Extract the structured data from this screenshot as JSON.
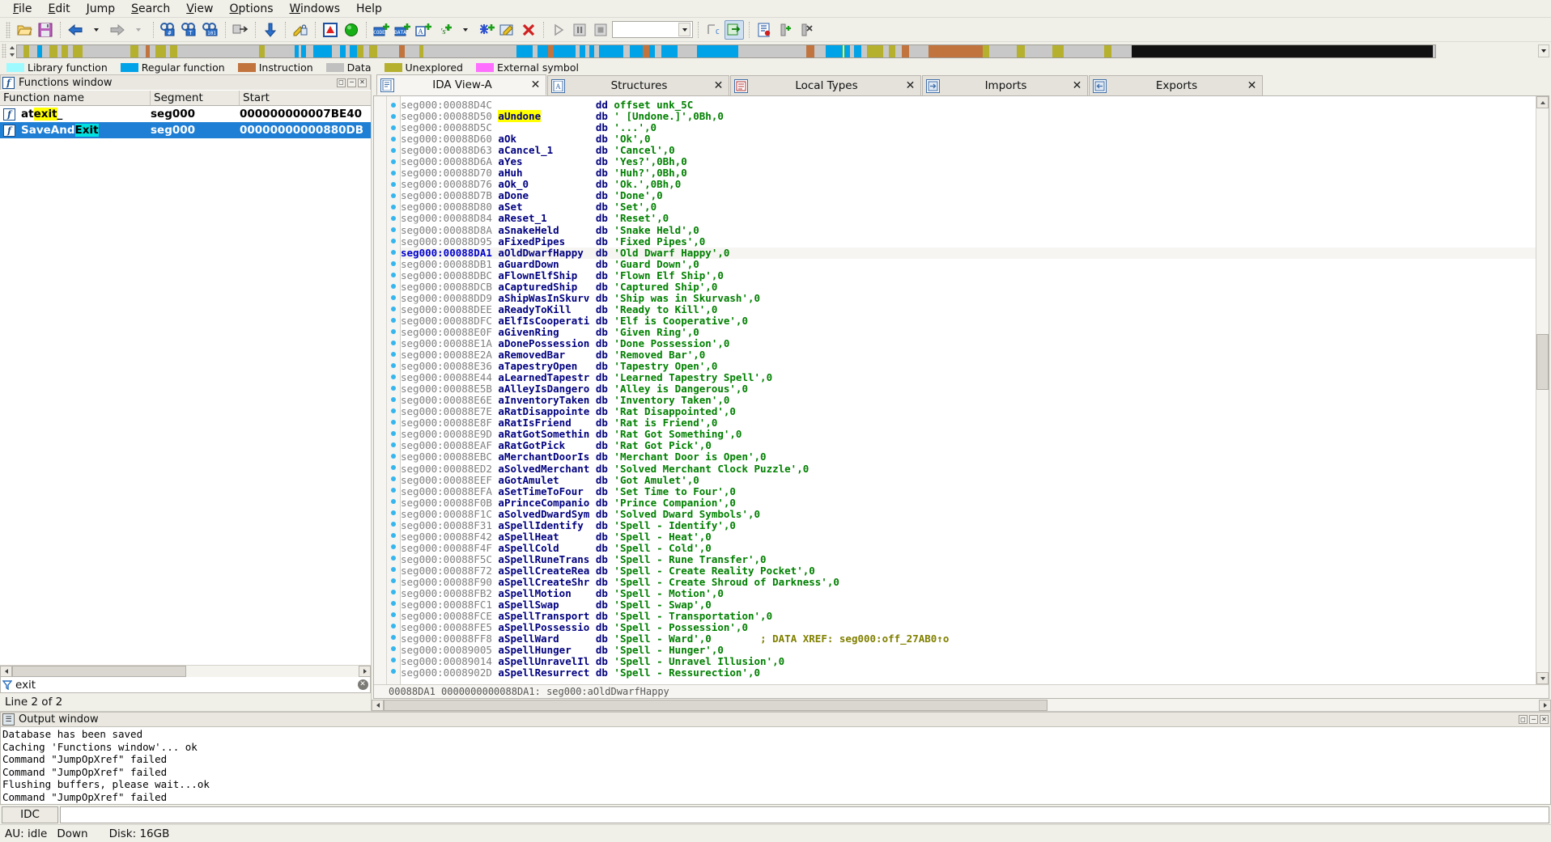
{
  "menu": {
    "items": [
      {
        "label": "File",
        "accel": "F"
      },
      {
        "label": "Edit",
        "accel": "E"
      },
      {
        "label": "Jump",
        "accel": "J"
      },
      {
        "label": "Search",
        "accel": "S"
      },
      {
        "label": "View",
        "accel": "V"
      },
      {
        "label": "Options",
        "accel": "O"
      },
      {
        "label": "Windows",
        "accel": "W"
      },
      {
        "label": "Help",
        "accel": "H"
      }
    ]
  },
  "toolbar": {
    "combo_value": "",
    "icons": [
      "open-file-icon",
      "save-icon",
      "navigate-back-icon",
      "back-dropdown-icon",
      "navigate-forward-icon",
      "forward-dropdown-icon",
      "search-hash-icon",
      "search-text-icon",
      "search-binary-icon",
      "jump-xref-icon",
      "jump-down-icon",
      "edit-function-icon",
      "warning-icon",
      "run-icon",
      "make-code-icon",
      "make-data-icon",
      "make-ascii-icon",
      "make-struct-icon",
      "struct-dropdown-icon",
      "make-unexplored-icon",
      "edit-icon",
      "delete-icon",
      "run-debugger-icon",
      "pause-icon",
      "stop-icon",
      "trace-icon",
      "step-icon",
      "notepad-icon",
      "breakpoint-add-icon",
      "breakpoint-delete-icon"
    ]
  },
  "navband": {
    "segments": [
      {
        "color": "#c8c8c8",
        "width": 0.5
      },
      {
        "color": "#b5b02e",
        "width": 0.4
      },
      {
        "color": "#c8c8c8",
        "width": 0.6
      },
      {
        "color": "#00a2e8",
        "width": 0.35
      },
      {
        "color": "#c8c8c8",
        "width": 0.5
      },
      {
        "color": "#b5b02e",
        "width": 0.6
      },
      {
        "color": "#c8c8c8",
        "width": 0.3
      },
      {
        "color": "#b5b02e",
        "width": 0.5
      },
      {
        "color": "#c8c8c8",
        "width": 0.35
      },
      {
        "color": "#b5b02e",
        "width": 0.7
      },
      {
        "color": "#c8c8c8",
        "width": 3.5
      },
      {
        "color": "#b5b02e",
        "width": 0.6
      },
      {
        "color": "#c8c8c8",
        "width": 0.5
      },
      {
        "color": "#c1743e",
        "width": 0.3
      },
      {
        "color": "#c8c8c8",
        "width": 0.4
      },
      {
        "color": "#b5b02e",
        "width": 0.8
      },
      {
        "color": "#c8c8c8",
        "width": 0.3
      },
      {
        "color": "#b5b02e",
        "width": 0.5
      },
      {
        "color": "#c8c8c8",
        "width": 6.0
      },
      {
        "color": "#b5b02e",
        "width": 0.4
      },
      {
        "color": "#c8c8c8",
        "width": 2.2
      },
      {
        "color": "#00a2e8",
        "width": 0.3
      },
      {
        "color": "#c8c8c8",
        "width": 0.2
      },
      {
        "color": "#00a2e8",
        "width": 0.35
      },
      {
        "color": "#c8c8c8",
        "width": 0.5
      },
      {
        "color": "#00a2e8",
        "width": 1.4
      },
      {
        "color": "#c8c8c8",
        "width": 0.6
      },
      {
        "color": "#00a2e8",
        "width": 0.4
      },
      {
        "color": "#c8c8c8",
        "width": 0.3
      },
      {
        "color": "#00a2e8",
        "width": 0.5
      },
      {
        "color": "#b5b02e",
        "width": 0.5
      },
      {
        "color": "#c8c8c8",
        "width": 0.4
      },
      {
        "color": "#b5b02e",
        "width": 0.6
      },
      {
        "color": "#c8c8c8",
        "width": 1.6
      },
      {
        "color": "#c1743e",
        "width": 0.4
      },
      {
        "color": "#c8c8c8",
        "width": 1.1
      },
      {
        "color": "#b5b02e",
        "width": 0.3
      },
      {
        "color": "#c8c8c8",
        "width": 6.8
      },
      {
        "color": "#00a2e8",
        "width": 1.2
      },
      {
        "color": "#c8c8c8",
        "width": 0.3
      },
      {
        "color": "#00a2e8",
        "width": 0.8
      },
      {
        "color": "#c1743e",
        "width": 0.4
      },
      {
        "color": "#00a2e8",
        "width": 1.6
      },
      {
        "color": "#c8c8c8",
        "width": 0.3
      },
      {
        "color": "#00a2e8",
        "width": 0.4
      },
      {
        "color": "#c8c8c8",
        "width": 0.3
      },
      {
        "color": "#00a2e8",
        "width": 0.4
      },
      {
        "color": "#c8c8c8",
        "width": 0.3
      },
      {
        "color": "#00a2e8",
        "width": 1.8
      },
      {
        "color": "#c8c8c8",
        "width": 0.5
      },
      {
        "color": "#00a2e8",
        "width": 0.9
      },
      {
        "color": "#c1743e",
        "width": 0.5
      },
      {
        "color": "#00a2e8",
        "width": 0.4
      },
      {
        "color": "#c8c8c8",
        "width": 0.5
      },
      {
        "color": "#00a2e8",
        "width": 1.2
      },
      {
        "color": "#c8c8c8",
        "width": 1.4
      },
      {
        "color": "#00a2e8",
        "width": 3.0
      },
      {
        "color": "#c8c8c8",
        "width": 5.0
      },
      {
        "color": "#c1743e",
        "width": 0.6
      },
      {
        "color": "#c8c8c8",
        "width": 0.8
      },
      {
        "color": "#00a2e8",
        "width": 1.8
      },
      {
        "color": "#c8c8c8",
        "width": 0.3
      },
      {
        "color": "#00a2e8",
        "width": 0.5
      },
      {
        "color": "#c8c8c8",
        "width": 0.4
      },
      {
        "color": "#b5b02e",
        "width": 1.2
      },
      {
        "color": "#c8c8c8",
        "width": 0.4
      },
      {
        "color": "#b5b02e",
        "width": 0.5
      },
      {
        "color": "#c8c8c8",
        "width": 0.5
      },
      {
        "color": "#c1743e",
        "width": 0.5
      },
      {
        "color": "#c8c8c8",
        "width": 1.4
      },
      {
        "color": "#c1743e",
        "width": 4.0
      },
      {
        "color": "#b5b02e",
        "width": 0.5
      },
      {
        "color": "#c8c8c8",
        "width": 2.0
      },
      {
        "color": "#b5b02e",
        "width": 0.6
      },
      {
        "color": "#c8c8c8",
        "width": 2.0
      },
      {
        "color": "#b5b02e",
        "width": 0.8
      },
      {
        "color": "#c8c8c8",
        "width": 3.0
      },
      {
        "color": "#b5b02e",
        "width": 0.5
      },
      {
        "color": "#c8c8c8",
        "width": 1.5
      },
      {
        "color": "#111111",
        "width": 22.0
      },
      {
        "color": "#c8c8c8",
        "width": 0.2
      }
    ]
  },
  "legend": {
    "entries": [
      {
        "label": "Library function",
        "color": "#9ffaff"
      },
      {
        "label": "Regular function",
        "color": "#00a2e8"
      },
      {
        "label": "Instruction",
        "color": "#c1743e"
      },
      {
        "label": "Data",
        "color": "#c0c0c0"
      },
      {
        "label": "Unexplored",
        "color": "#b5b02e"
      },
      {
        "label": "External symbol",
        "color": "#ff6fff"
      }
    ]
  },
  "functions_window": {
    "title": "Functions window",
    "title_icon": "function-icon",
    "window_buttons": [
      "restore-button",
      "minimize-button",
      "close-button"
    ],
    "columns": [
      "Function name",
      "Segment",
      "Start"
    ],
    "rows": [
      {
        "icon": "function-icon",
        "name_pre": "at",
        "name_hl": "exit",
        "name_hl_color": "#ffff00",
        "name_post": "_",
        "segment": "seg000",
        "start": "000000000007BE40",
        "selected": false
      },
      {
        "icon": "function-icon",
        "name_pre": "SaveAnd",
        "name_hl": "Exit",
        "name_hl_color": "#00e0e0",
        "name_post": "",
        "segment": "seg000",
        "start": "00000000000880DB",
        "selected": true
      }
    ],
    "filter_value": "exit",
    "filter_placeholder": "",
    "status": "Line 2 of 2"
  },
  "tabs": [
    {
      "label": "IDA View-A",
      "icon": "ida-view-icon",
      "active": true,
      "close": "✕"
    },
    {
      "label": "Structures",
      "icon": "structures-icon",
      "active": false,
      "close": "✕"
    },
    {
      "label": "Local Types",
      "icon": "local-types-icon",
      "active": false,
      "close": "✕"
    },
    {
      "label": "Imports",
      "icon": "imports-icon",
      "active": false,
      "close": "✕"
    },
    {
      "label": "Exports",
      "icon": "exports-icon",
      "active": false,
      "close": "✕"
    }
  ],
  "disassembly": {
    "status_line": "00088DA1 0000000000088DA1: seg000:aOldDwarfHappy",
    "lines": [
      {
        "addr": "seg000:00088D4C",
        "name": "",
        "op": "dd",
        "operand": "offset unk_5C",
        "operand_kind": "name",
        "cur": false
      },
      {
        "addr": "seg000:00088D50",
        "name": "aUndone",
        "name_hl": true,
        "op": "db",
        "operand": "' [Undone.]',0Bh,0",
        "cur": false
      },
      {
        "addr": "seg000:00088D5C",
        "name": "",
        "op": "db",
        "operand": "'...',0",
        "cur": false
      },
      {
        "addr": "seg000:00088D60",
        "name": "aOk",
        "op": "db",
        "operand": "'Ok',0",
        "cur": false
      },
      {
        "addr": "seg000:00088D63",
        "name": "aCancel_1",
        "op": "db",
        "operand": "'Cancel',0",
        "cur": false
      },
      {
        "addr": "seg000:00088D6A",
        "name": "aYes",
        "op": "db",
        "operand": "'Yes?',0Bh,0",
        "cur": false
      },
      {
        "addr": "seg000:00088D70",
        "name": "aHuh",
        "op": "db",
        "operand": "'Huh?',0Bh,0",
        "cur": false
      },
      {
        "addr": "seg000:00088D76",
        "name": "aOk_0",
        "op": "db",
        "operand": "'Ok.',0Bh,0",
        "cur": false
      },
      {
        "addr": "seg000:00088D7B",
        "name": "aDone",
        "op": "db",
        "operand": "'Done',0",
        "cur": false
      },
      {
        "addr": "seg000:00088D80",
        "name": "aSet",
        "op": "db",
        "operand": "'Set',0",
        "cur": false
      },
      {
        "addr": "seg000:00088D84",
        "name": "aReset_1",
        "op": "db",
        "operand": "'Reset',0",
        "cur": false
      },
      {
        "addr": "seg000:00088D8A",
        "name": "aSnakeHeld",
        "op": "db",
        "operand": "'Snake Held',0",
        "cur": false
      },
      {
        "addr": "seg000:00088D95",
        "name": "aFixedPipes",
        "op": "db",
        "operand": "'Fixed Pipes',0",
        "cur": false
      },
      {
        "addr": "seg000:00088DA1",
        "name": "aOldDwarfHappy",
        "op": "db",
        "operand": "'Old Dwarf Happy',0",
        "cur": true
      },
      {
        "addr": "seg000:00088DB1",
        "name": "aGuardDown",
        "op": "db",
        "operand": "'Guard Down',0",
        "cur": false
      },
      {
        "addr": "seg000:00088DBC",
        "name": "aFlownElfShip",
        "op": "db",
        "operand": "'Flown Elf Ship',0",
        "cur": false
      },
      {
        "addr": "seg000:00088DCB",
        "name": "aCapturedShip",
        "op": "db",
        "operand": "'Captured Ship',0",
        "cur": false
      },
      {
        "addr": "seg000:00088DD9",
        "name": "aShipWasInSkurv",
        "op": "db",
        "operand": "'Ship was in Skurvash',0",
        "cur": false
      },
      {
        "addr": "seg000:00088DEE",
        "name": "aReadyToKill",
        "op": "db",
        "operand": "'Ready to Kill',0",
        "cur": false
      },
      {
        "addr": "seg000:00088DFC",
        "name": "aElfIsCooperati",
        "op": "db",
        "operand": "'Elf is Cooperative',0",
        "cur": false
      },
      {
        "addr": "seg000:00088E0F",
        "name": "aGivenRing",
        "op": "db",
        "operand": "'Given Ring',0",
        "cur": false
      },
      {
        "addr": "seg000:00088E1A",
        "name": "aDonePossession",
        "op": "db",
        "operand": "'Done Possession',0",
        "cur": false
      },
      {
        "addr": "seg000:00088E2A",
        "name": "aRemovedBar",
        "op": "db",
        "operand": "'Removed Bar',0",
        "cur": false
      },
      {
        "addr": "seg000:00088E36",
        "name": "aTapestryOpen",
        "op": "db",
        "operand": "'Tapestry Open',0",
        "cur": false
      },
      {
        "addr": "seg000:00088E44",
        "name": "aLearnedTapestr",
        "op": "db",
        "operand": "'Learned Tapestry Spell',0",
        "cur": false
      },
      {
        "addr": "seg000:00088E5B",
        "name": "aAlleyIsDangero",
        "op": "db",
        "operand": "'Alley is Dangerous',0",
        "cur": false
      },
      {
        "addr": "seg000:00088E6E",
        "name": "aInventoryTaken",
        "op": "db",
        "operand": "'Inventory Taken',0",
        "cur": false
      },
      {
        "addr": "seg000:00088E7E",
        "name": "aRatDisappointe",
        "op": "db",
        "operand": "'Rat Disappointed',0",
        "cur": false
      },
      {
        "addr": "seg000:00088E8F",
        "name": "aRatIsFriend",
        "op": "db",
        "operand": "'Rat is Friend',0",
        "cur": false
      },
      {
        "addr": "seg000:00088E9D",
        "name": "aRatGotSomethin",
        "op": "db",
        "operand": "'Rat Got Something',0",
        "cur": false
      },
      {
        "addr": "seg000:00088EAF",
        "name": "aRatGotPick",
        "op": "db",
        "operand": "'Rat Got Pick',0",
        "cur": false
      },
      {
        "addr": "seg000:00088EBC",
        "name": "aMerchantDoorIs",
        "op": "db",
        "operand": "'Merchant Door is Open',0",
        "cur": false
      },
      {
        "addr": "seg000:00088ED2",
        "name": "aSolvedMerchant",
        "op": "db",
        "operand": "'Solved Merchant Clock Puzzle',0",
        "cur": false
      },
      {
        "addr": "seg000:00088EEF",
        "name": "aGotAmulet",
        "op": "db",
        "operand": "'Got Amulet',0",
        "cur": false
      },
      {
        "addr": "seg000:00088EFA",
        "name": "aSetTimeToFour",
        "op": "db",
        "operand": "'Set Time to Four',0",
        "cur": false
      },
      {
        "addr": "seg000:00088F0B",
        "name": "aPrinceCompanio",
        "op": "db",
        "operand": "'Prince Companion',0",
        "cur": false
      },
      {
        "addr": "seg000:00088F1C",
        "name": "aSolvedDwardSym",
        "op": "db",
        "operand": "'Solved Dward Symbols',0",
        "cur": false
      },
      {
        "addr": "seg000:00088F31",
        "name": "aSpellIdentify",
        "op": "db",
        "operand": "'Spell - Identify',0",
        "cur": false
      },
      {
        "addr": "seg000:00088F42",
        "name": "aSpellHeat",
        "op": "db",
        "operand": "'Spell - Heat',0",
        "cur": false
      },
      {
        "addr": "seg000:00088F4F",
        "name": "aSpellCold",
        "op": "db",
        "operand": "'Spell - Cold',0",
        "cur": false
      },
      {
        "addr": "seg000:00088F5C",
        "name": "aSpellRuneTrans",
        "op": "db",
        "operand": "'Spell - Rune Transfer',0",
        "cur": false
      },
      {
        "addr": "seg000:00088F72",
        "name": "aSpellCreateRea",
        "op": "db",
        "operand": "'Spell - Create Reality Pocket',0",
        "cur": false
      },
      {
        "addr": "seg000:00088F90",
        "name": "aSpellCreateShr",
        "op": "db",
        "operand": "'Spell - Create Shroud of Darkness',0",
        "cur": false
      },
      {
        "addr": "seg000:00088FB2",
        "name": "aSpellMotion",
        "op": "db",
        "operand": "'Spell - Motion',0",
        "cur": false
      },
      {
        "addr": "seg000:00088FC1",
        "name": "aSpellSwap",
        "op": "db",
        "operand": "'Spell - Swap',0",
        "cur": false
      },
      {
        "addr": "seg000:00088FCE",
        "name": "aSpellTransport",
        "op": "db",
        "operand": "'Spell - Transportation',0",
        "cur": false
      },
      {
        "addr": "seg000:00088FE5",
        "name": "aSpellPossessio",
        "op": "db",
        "operand": "'Spell - Possession',0",
        "cur": false
      },
      {
        "addr": "seg000:00088FF8",
        "name": "aSpellWard",
        "op": "db",
        "operand": "'Spell - Ward',0",
        "comment": "; DATA XREF: seg000:off_27AB0↑o",
        "cur": false
      },
      {
        "addr": "seg000:00089005",
        "name": "aSpellHunger",
        "op": "db",
        "operand": "'Spell - Hunger',0",
        "cur": false
      },
      {
        "addr": "seg000:00089014",
        "name": "aSpellUnravelIl",
        "op": "db",
        "operand": "'Spell - Unravel Illusion',0",
        "cur": false
      },
      {
        "addr": "seg000:0008902D",
        "name": "aSpellResurrect",
        "op": "db",
        "operand": "'Spell - Ressurection',0",
        "cur": false
      }
    ]
  },
  "output_window": {
    "title": "Output window",
    "title_icon": "output-icon",
    "window_buttons": [
      "restore-button",
      "minimize-button",
      "close-button"
    ],
    "lines": [
      "Database has been saved",
      "Caching 'Functions window'... ok",
      "Command \"JumpOpXref\" failed",
      "Command \"JumpOpXref\" failed",
      "Flushing buffers, please wait...ok",
      "Command \"JumpOpXref\" failed"
    ],
    "idc_label": "IDC",
    "command_value": "",
    "command_placeholder": ""
  },
  "statusbar": {
    "au": "AU: idle",
    "state": "Down",
    "disk": "Disk: 16GB"
  },
  "colors": {
    "selection_blue": "#1f7fd4",
    "highlight_yellow": "#ffff00",
    "highlight_cyan": "#00e0e0",
    "string_green": "#008000",
    "name_navy": "#000080",
    "comment_olive": "#808000",
    "address_gray": "#808080",
    "cursor_blue": "#0000cd"
  }
}
